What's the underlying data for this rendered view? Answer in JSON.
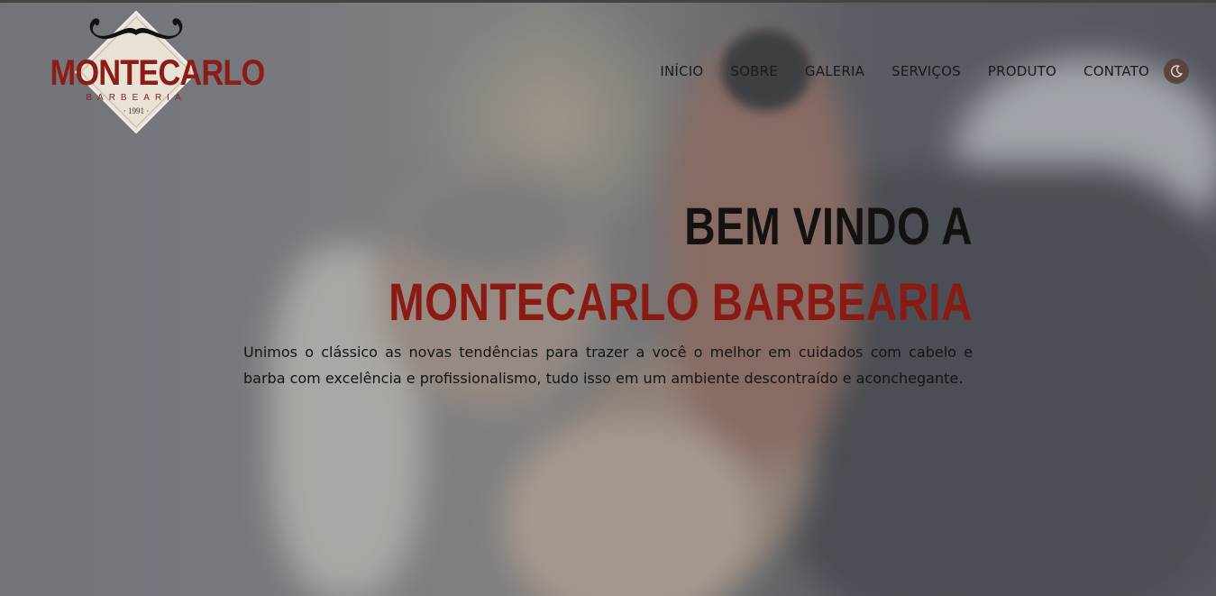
{
  "brand": {
    "name": "MONTECARLO",
    "subtitle": "BARBEARIA",
    "year": "· 1991 ·",
    "logo_icon": "mustache-diamond-logo",
    "primary_color": "#8b1c16"
  },
  "nav": {
    "items": [
      {
        "label": "INÍCIO"
      },
      {
        "label": "SOBRE"
      },
      {
        "label": "GALERIA"
      },
      {
        "label": "SERVIÇOS"
      },
      {
        "label": "PRODUTO"
      },
      {
        "label": "CONTATO"
      }
    ],
    "theme_toggle_icon": "moon-icon"
  },
  "hero": {
    "heading_line1": "BEM VINDO A",
    "heading_line2": "MONTECARLO BARBEARIA",
    "description": "Unimos o clássico as novas tendências para trazer a você o melhor em cuidados com cabelo e barba com excelência e profissionalismo, tudo isso em um ambiente descontraído e aconchegante.",
    "heading_color": "#141210",
    "accent_color": "#8a1a14"
  }
}
